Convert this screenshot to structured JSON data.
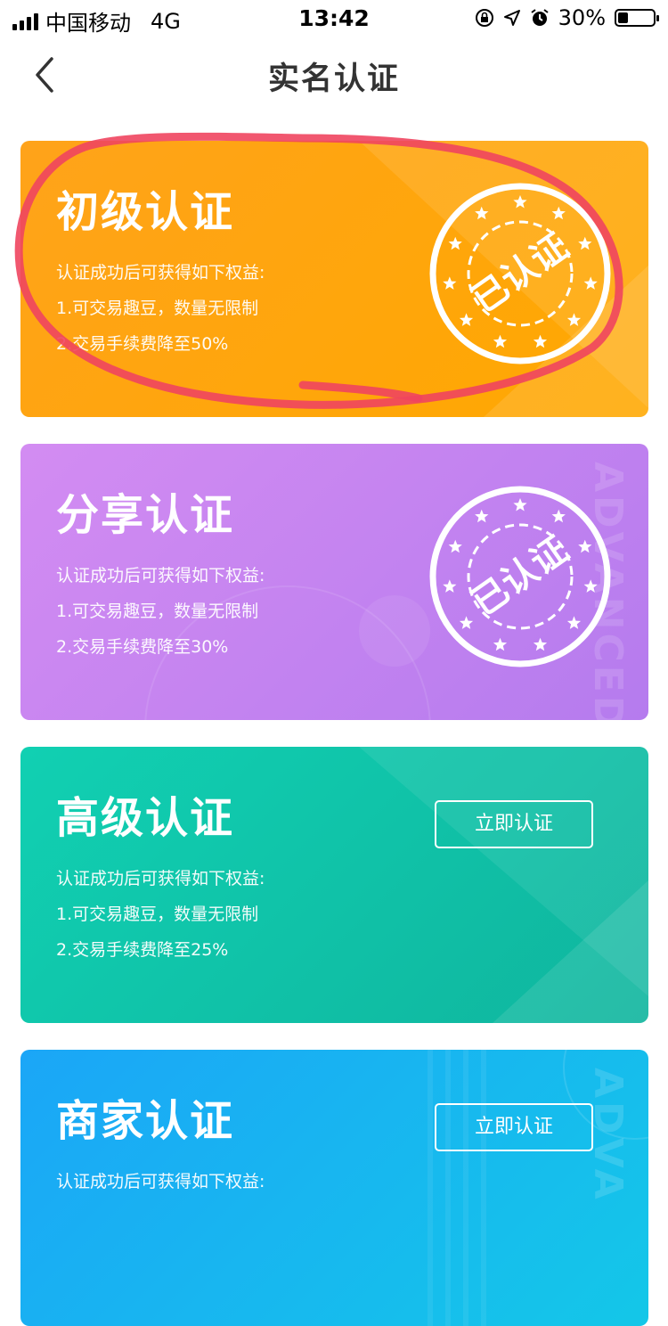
{
  "status_bar": {
    "carrier": "中国移动",
    "network": "4G",
    "time": "13:42",
    "battery_text": "30%",
    "battery_level": 0.3
  },
  "nav": {
    "title": "实名认证"
  },
  "cards": [
    {
      "title": "初级认证",
      "desc_intro": "认证成功后可获得如下权益:",
      "benefit1": "1.可交易趣豆，数量无限制",
      "benefit2": "2.交易手续费降至50%",
      "stamp_text": "已认证",
      "status": "verified",
      "color_from": "#FFA31A",
      "color_to": "#FFA800"
    },
    {
      "title": "分享认证",
      "desc_intro": "认证成功后可获得如下权益:",
      "benefit1": "1.可交易趣豆，数量无限制",
      "benefit2": "2.交易手续费降至30%",
      "stamp_text": "已认证",
      "watermark": "ADVANCED",
      "status": "verified",
      "color_from": "#D38CF2",
      "color_to": "#B57BEE"
    },
    {
      "title": "高级认证",
      "desc_intro": "认证成功后可获得如下权益:",
      "benefit1": "1.可交易趣豆，数量无限制",
      "benefit2": "2.交易手续费降至25%",
      "button_label": "立即认证",
      "status": "unverified",
      "color_from": "#11D0B2",
      "color_to": "#0FB59E"
    },
    {
      "title": "商家认证",
      "desc_intro": "认证成功后可获得如下权益:",
      "button_label": "立即认证",
      "watermark": "ADVA",
      "status": "unverified",
      "color_from": "#1BA6F7",
      "color_to": "#14C7E8"
    }
  ],
  "annotation_color": "#F0455F"
}
